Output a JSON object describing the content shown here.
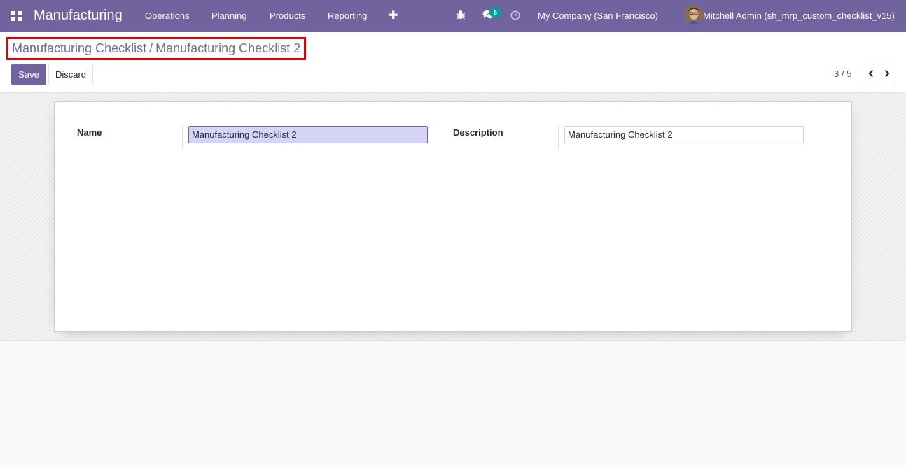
{
  "navbar": {
    "app_title": "Manufacturing",
    "menu": [
      "Operations",
      "Planning",
      "Products",
      "Reporting"
    ],
    "messages_count": "5",
    "company": "My Company (San Francisco)",
    "user": "Mitchell Admin (sh_mrp_custom_checklist_v15)"
  },
  "breadcrumb": {
    "parent": "Manufacturing Checklist",
    "separator": "/",
    "current": "Manufacturing Checklist 2"
  },
  "buttons": {
    "save": "Save",
    "discard": "Discard"
  },
  "pager": {
    "value": "3 / 5"
  },
  "form": {
    "name_label": "Name",
    "name_value": "Manufacturing Checklist 2",
    "description_label": "Description",
    "description_value": "Manufacturing Checklist 2"
  },
  "colors": {
    "brand": "#71639e",
    "highlight": "#e30000",
    "badge": "#00a09d",
    "focused_field": "#d5d4f8"
  },
  "icons": [
    "apps-icon",
    "plus-icon",
    "bug-icon",
    "chat-icon",
    "clock-icon",
    "chevron-left-icon",
    "chevron-right-icon"
  ]
}
